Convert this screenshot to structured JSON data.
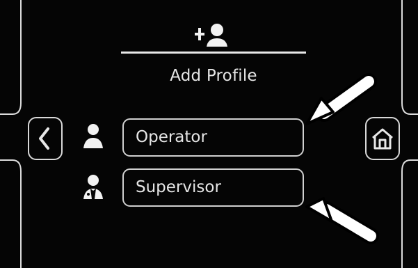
{
  "add_profile": {
    "label": "Add Profile",
    "icon": "add-user-icon"
  },
  "navigation": {
    "back_icon": "chevron-left-icon",
    "home_icon": "home-icon"
  },
  "profiles": [
    {
      "label": "Operator",
      "icon": "operator-user-icon"
    },
    {
      "label": "Supervisor",
      "icon": "supervisor-user-icon"
    }
  ],
  "annotations": {
    "arrow_icon": "annotation-arrow-icon",
    "arrow_color": "#ffffff"
  },
  "colors": {
    "background": "#050505",
    "foreground": "#e6e6e6",
    "outline": "#d8d8d8"
  }
}
